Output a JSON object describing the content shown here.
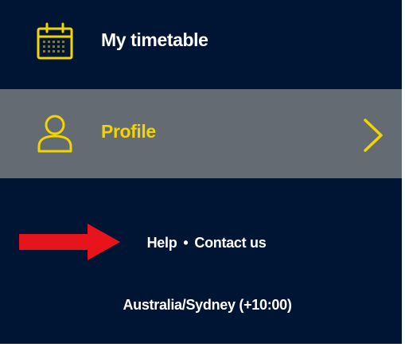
{
  "nav": {
    "items": [
      {
        "label": "My timetable",
        "icon": "calendar-icon",
        "active": false
      },
      {
        "label": "Profile",
        "icon": "user-icon",
        "active": true,
        "trailing_icon": "chevron-right-icon"
      }
    ]
  },
  "footer": {
    "help_label": "Help",
    "separator": "•",
    "contact_label": "Contact us",
    "timezone": "Australia/Sydney (+10:00)"
  },
  "annotation": {
    "type": "arrow",
    "points_to": "help-link",
    "color": "#e8141b"
  },
  "colors": {
    "background": "#001533",
    "active_item_background": "#646b72",
    "accent": "#f2d500",
    "text": "#ffffff"
  }
}
